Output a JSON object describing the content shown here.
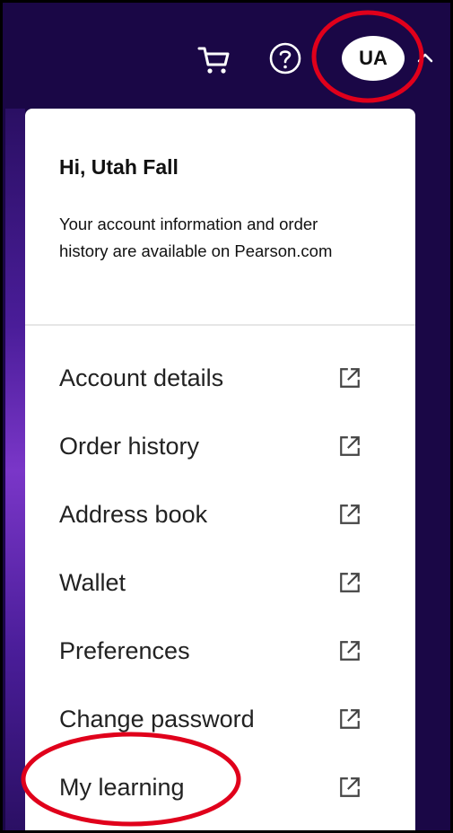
{
  "header": {
    "avatar_initials": "UA",
    "icons": [
      "cart-icon",
      "help-icon",
      "chevron-up-icon"
    ]
  },
  "account_menu": {
    "greeting": "Hi, Utah Fall",
    "info_text": "Your account information and order history are available on Pearson.com",
    "items": [
      {
        "label": "Account details",
        "icon": "external-link-icon"
      },
      {
        "label": "Order history",
        "icon": "external-link-icon"
      },
      {
        "label": "Address book",
        "icon": "external-link-icon"
      },
      {
        "label": "Wallet",
        "icon": "external-link-icon"
      },
      {
        "label": "Preferences",
        "icon": "external-link-icon"
      },
      {
        "label": "Change password",
        "icon": "external-link-icon"
      },
      {
        "label": "My learning",
        "icon": "external-link-icon"
      }
    ]
  },
  "colors": {
    "header_background": "#1a0746",
    "panel_background": "#ffffff",
    "annotation": "#e0001b"
  }
}
